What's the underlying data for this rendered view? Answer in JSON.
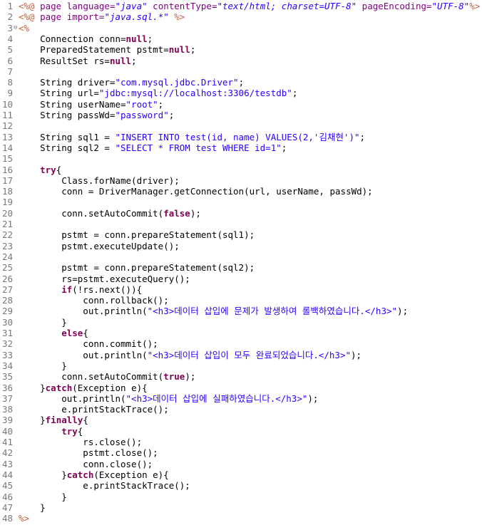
{
  "editor": {
    "lines": [
      {
        "n": "1",
        "fold": "",
        "segs": [
          {
            "t": "<%@ ",
            "c": "tag"
          },
          {
            "t": "page ",
            "c": "attr"
          },
          {
            "t": "language=",
            "c": "attr"
          },
          {
            "t": "\"java\"",
            "c": "attrv"
          },
          {
            "t": " contentType=",
            "c": "attr"
          },
          {
            "t": "\"text/html; charset=UTF-8\"",
            "c": "attrv"
          },
          {
            "t": " pageEncoding=",
            "c": "attr"
          },
          {
            "t": "\"UTF-8\"",
            "c": "attrv"
          },
          {
            "t": "%>",
            "c": "tag"
          }
        ]
      },
      {
        "n": "2",
        "fold": "",
        "segs": [
          {
            "t": "<%@ ",
            "c": "tag"
          },
          {
            "t": "page ",
            "c": "attr"
          },
          {
            "t": "import=",
            "c": "attr"
          },
          {
            "t": "\"java.sql.*\"",
            "c": "attrv"
          },
          {
            "t": " %>",
            "c": "tag"
          }
        ]
      },
      {
        "n": "3",
        "fold": "⊖",
        "segs": [
          {
            "t": "<%",
            "c": "tag"
          }
        ]
      },
      {
        "n": "4",
        "fold": "",
        "segs": [
          {
            "t": "    Connection conn=",
            "c": ""
          },
          {
            "t": "null",
            "c": "kw"
          },
          {
            "t": ";",
            "c": ""
          }
        ]
      },
      {
        "n": "5",
        "fold": "",
        "segs": [
          {
            "t": "    PreparedStatement pstmt=",
            "c": ""
          },
          {
            "t": "null",
            "c": "kw"
          },
          {
            "t": ";",
            "c": ""
          }
        ]
      },
      {
        "n": "6",
        "fold": "",
        "segs": [
          {
            "t": "    ResultSet rs=",
            "c": ""
          },
          {
            "t": "null",
            "c": "kw"
          },
          {
            "t": ";",
            "c": ""
          }
        ]
      },
      {
        "n": "7",
        "fold": "",
        "segs": []
      },
      {
        "n": "8",
        "fold": "",
        "segs": [
          {
            "t": "    String driver=",
            "c": ""
          },
          {
            "t": "\"com.mysql.jdbc.Driver\"",
            "c": "str"
          },
          {
            "t": ";",
            "c": ""
          }
        ]
      },
      {
        "n": "9",
        "fold": "",
        "segs": [
          {
            "t": "    String url=",
            "c": ""
          },
          {
            "t": "\"jdbc:mysql://localhost:3306/testdb\"",
            "c": "str"
          },
          {
            "t": ";",
            "c": ""
          }
        ]
      },
      {
        "n": "10",
        "fold": "",
        "segs": [
          {
            "t": "    String userName=",
            "c": ""
          },
          {
            "t": "\"root\"",
            "c": "str"
          },
          {
            "t": ";",
            "c": ""
          }
        ]
      },
      {
        "n": "11",
        "fold": "",
        "segs": [
          {
            "t": "    String passWd=",
            "c": ""
          },
          {
            "t": "\"password\"",
            "c": "str"
          },
          {
            "t": ";",
            "c": ""
          }
        ]
      },
      {
        "n": "12",
        "fold": "",
        "segs": []
      },
      {
        "n": "13",
        "fold": "",
        "segs": [
          {
            "t": "    String sql1 = ",
            "c": ""
          },
          {
            "t": "\"INSERT INTO test(id, name) VALUES(2,'김채현')\"",
            "c": "str"
          },
          {
            "t": ";",
            "c": ""
          }
        ]
      },
      {
        "n": "14",
        "fold": "",
        "segs": [
          {
            "t": "    String sql2 = ",
            "c": ""
          },
          {
            "t": "\"SELECT * FROM test WHERE id=1\"",
            "c": "str"
          },
          {
            "t": ";",
            "c": ""
          }
        ]
      },
      {
        "n": "15",
        "fold": "",
        "segs": []
      },
      {
        "n": "16",
        "fold": "",
        "segs": [
          {
            "t": "    ",
            "c": ""
          },
          {
            "t": "try",
            "c": "kw"
          },
          {
            "t": "{",
            "c": ""
          }
        ]
      },
      {
        "n": "17",
        "fold": "",
        "segs": [
          {
            "t": "        Class.forName(driver);",
            "c": ""
          }
        ]
      },
      {
        "n": "18",
        "fold": "",
        "segs": [
          {
            "t": "        conn = DriverManager.getConnection(url, userName, passWd);",
            "c": ""
          }
        ]
      },
      {
        "n": "19",
        "fold": "",
        "segs": []
      },
      {
        "n": "20",
        "fold": "",
        "segs": [
          {
            "t": "        conn.setAutoCommit(",
            "c": ""
          },
          {
            "t": "false",
            "c": "kw"
          },
          {
            "t": ");",
            "c": ""
          }
        ]
      },
      {
        "n": "21",
        "fold": "",
        "segs": []
      },
      {
        "n": "22",
        "fold": "",
        "segs": [
          {
            "t": "        pstmt = conn.prepareStatement(sql1);",
            "c": ""
          }
        ]
      },
      {
        "n": "23",
        "fold": "",
        "segs": [
          {
            "t": "        pstmt.executeUpdate();",
            "c": ""
          }
        ]
      },
      {
        "n": "24",
        "fold": "",
        "segs": []
      },
      {
        "n": "25",
        "fold": "",
        "segs": [
          {
            "t": "        pstmt = conn.prepareStatement(sql2);",
            "c": ""
          }
        ]
      },
      {
        "n": "26",
        "fold": "",
        "segs": [
          {
            "t": "        rs=pstmt.executeQuery();",
            "c": ""
          }
        ]
      },
      {
        "n": "27",
        "fold": "",
        "segs": [
          {
            "t": "        ",
            "c": ""
          },
          {
            "t": "if",
            "c": "kw"
          },
          {
            "t": "(!rs.next()){",
            "c": ""
          }
        ]
      },
      {
        "n": "28",
        "fold": "",
        "segs": [
          {
            "t": "            conn.rollback();",
            "c": ""
          }
        ]
      },
      {
        "n": "29",
        "fold": "",
        "segs": [
          {
            "t": "            out.println(",
            "c": ""
          },
          {
            "t": "\"<h3>데이터 삽입에 문제가 발생하여 롤백하였습니다.</h3>\"",
            "c": "str"
          },
          {
            "t": ");",
            "c": ""
          }
        ]
      },
      {
        "n": "30",
        "fold": "",
        "segs": [
          {
            "t": "        }",
            "c": ""
          }
        ]
      },
      {
        "n": "31",
        "fold": "",
        "segs": [
          {
            "t": "        ",
            "c": ""
          },
          {
            "t": "else",
            "c": "kw"
          },
          {
            "t": "{",
            "c": ""
          }
        ]
      },
      {
        "n": "32",
        "fold": "",
        "segs": [
          {
            "t": "            conn.commit();",
            "c": ""
          }
        ]
      },
      {
        "n": "33",
        "fold": "",
        "segs": [
          {
            "t": "            out.println(",
            "c": ""
          },
          {
            "t": "\"<h3>데이터 삽입이 모두 완료되었습니다.</h3>\"",
            "c": "str"
          },
          {
            "t": ");",
            "c": ""
          }
        ]
      },
      {
        "n": "34",
        "fold": "",
        "segs": [
          {
            "t": "        }",
            "c": ""
          }
        ]
      },
      {
        "n": "35",
        "fold": "",
        "segs": [
          {
            "t": "        conn.setAutoCommit(",
            "c": ""
          },
          {
            "t": "true",
            "c": "kw"
          },
          {
            "t": ");",
            "c": ""
          }
        ]
      },
      {
        "n": "36",
        "fold": "",
        "segs": [
          {
            "t": "    }",
            "c": ""
          },
          {
            "t": "catch",
            "c": "kw"
          },
          {
            "t": "(Exception e){",
            "c": ""
          }
        ]
      },
      {
        "n": "37",
        "fold": "",
        "segs": [
          {
            "t": "        out.println(",
            "c": ""
          },
          {
            "t": "\"<h3>데이터 삽입에 실패하였습니다.</h3>\"",
            "c": "str"
          },
          {
            "t": ");",
            "c": ""
          }
        ]
      },
      {
        "n": "38",
        "fold": "",
        "segs": [
          {
            "t": "        e.printStackTrace();",
            "c": ""
          }
        ]
      },
      {
        "n": "39",
        "fold": "",
        "segs": [
          {
            "t": "    }",
            "c": ""
          },
          {
            "t": "finally",
            "c": "kw"
          },
          {
            "t": "{",
            "c": ""
          }
        ]
      },
      {
        "n": "40",
        "fold": "",
        "segs": [
          {
            "t": "        ",
            "c": ""
          },
          {
            "t": "try",
            "c": "kw"
          },
          {
            "t": "{",
            "c": ""
          }
        ]
      },
      {
        "n": "41",
        "fold": "",
        "segs": [
          {
            "t": "            rs.close();",
            "c": ""
          }
        ]
      },
      {
        "n": "42",
        "fold": "",
        "segs": [
          {
            "t": "            pstmt.close();",
            "c": ""
          }
        ]
      },
      {
        "n": "43",
        "fold": "",
        "segs": [
          {
            "t": "            conn.close();",
            "c": ""
          }
        ]
      },
      {
        "n": "44",
        "fold": "",
        "segs": [
          {
            "t": "        }",
            "c": ""
          },
          {
            "t": "catch",
            "c": "kw"
          },
          {
            "t": "(Exception e){",
            "c": ""
          }
        ]
      },
      {
        "n": "45",
        "fold": "",
        "segs": [
          {
            "t": "            e.printStackTrace();",
            "c": ""
          }
        ]
      },
      {
        "n": "46",
        "fold": "",
        "segs": [
          {
            "t": "        }",
            "c": ""
          }
        ]
      },
      {
        "n": "47",
        "fold": "",
        "segs": [
          {
            "t": "    }",
            "c": ""
          }
        ]
      },
      {
        "n": "48",
        "fold": "",
        "segs": [
          {
            "t": "%>",
            "c": "tag"
          }
        ]
      }
    ]
  }
}
